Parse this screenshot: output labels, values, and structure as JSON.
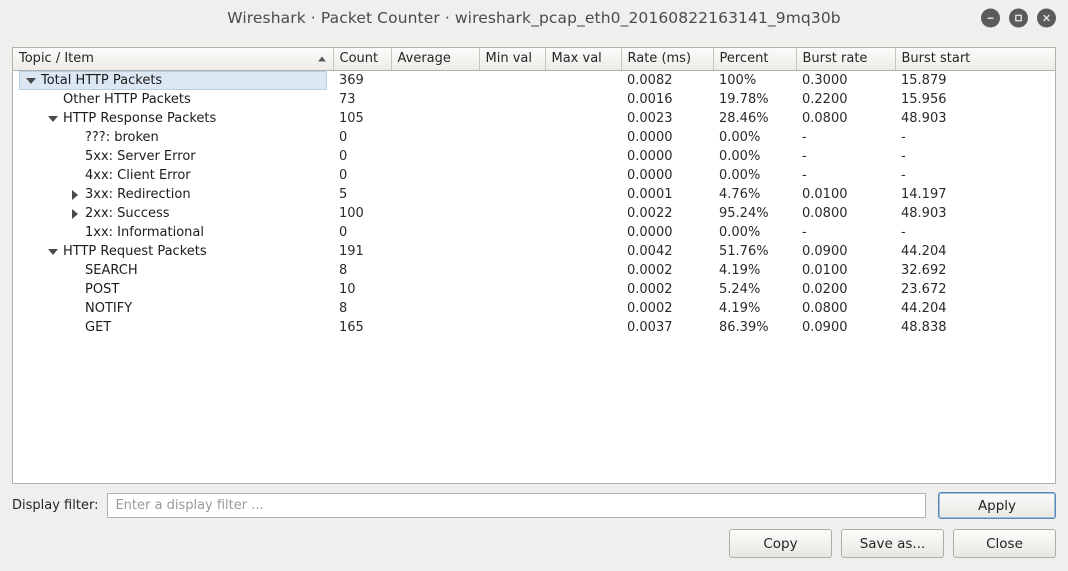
{
  "window": {
    "title": "Wireshark · Packet Counter · wireshark_pcap_eth0_20160822163141_9mq30b",
    "controls": {
      "minimize": "minimize",
      "maximize": "maximize",
      "close": "close"
    }
  },
  "table": {
    "columns": [
      "Topic / Item",
      "Count",
      "Average",
      "Min val",
      "Max val",
      "Rate (ms)",
      "Percent",
      "Burst rate",
      "Burst start"
    ],
    "sort": {
      "column": "Topic / Item",
      "direction": "ascending"
    },
    "rows": [
      {
        "label": "Total HTTP Packets",
        "indent": 0,
        "expander": "expanded",
        "selected": true,
        "count": "369",
        "average": "",
        "min_val": "",
        "max_val": "",
        "rate_ms": "0.0082",
        "percent": "100%",
        "burst_rate": "0.3000",
        "burst_start": "15.879"
      },
      {
        "label": "Other HTTP Packets",
        "indent": 1,
        "expander": "none",
        "selected": false,
        "count": "73",
        "average": "",
        "min_val": "",
        "max_val": "",
        "rate_ms": "0.0016",
        "percent": "19.78%",
        "burst_rate": "0.2200",
        "burst_start": "15.956"
      },
      {
        "label": "HTTP Response Packets",
        "indent": 1,
        "expander": "expanded",
        "selected": false,
        "count": "105",
        "average": "",
        "min_val": "",
        "max_val": "",
        "rate_ms": "0.0023",
        "percent": "28.46%",
        "burst_rate": "0.0800",
        "burst_start": "48.903"
      },
      {
        "label": "???: broken",
        "indent": 2,
        "expander": "none",
        "selected": false,
        "count": "0",
        "average": "",
        "min_val": "",
        "max_val": "",
        "rate_ms": "0.0000",
        "percent": "0.00%",
        "burst_rate": "-",
        "burst_start": "-"
      },
      {
        "label": "5xx: Server Error",
        "indent": 2,
        "expander": "none",
        "selected": false,
        "count": "0",
        "average": "",
        "min_val": "",
        "max_val": "",
        "rate_ms": "0.0000",
        "percent": "0.00%",
        "burst_rate": "-",
        "burst_start": "-"
      },
      {
        "label": "4xx: Client Error",
        "indent": 2,
        "expander": "none",
        "selected": false,
        "count": "0",
        "average": "",
        "min_val": "",
        "max_val": "",
        "rate_ms": "0.0000",
        "percent": "0.00%",
        "burst_rate": "-",
        "burst_start": "-"
      },
      {
        "label": "3xx: Redirection",
        "indent": 2,
        "expander": "collapsed",
        "selected": false,
        "count": "5",
        "average": "",
        "min_val": "",
        "max_val": "",
        "rate_ms": "0.0001",
        "percent": "4.76%",
        "burst_rate": "0.0100",
        "burst_start": "14.197"
      },
      {
        "label": "2xx: Success",
        "indent": 2,
        "expander": "collapsed",
        "selected": false,
        "count": "100",
        "average": "",
        "min_val": "",
        "max_val": "",
        "rate_ms": "0.0022",
        "percent": "95.24%",
        "burst_rate": "0.0800",
        "burst_start": "48.903"
      },
      {
        "label": "1xx: Informational",
        "indent": 2,
        "expander": "none",
        "selected": false,
        "count": "0",
        "average": "",
        "min_val": "",
        "max_val": "",
        "rate_ms": "0.0000",
        "percent": "0.00%",
        "burst_rate": "-",
        "burst_start": "-"
      },
      {
        "label": "HTTP Request Packets",
        "indent": 1,
        "expander": "expanded",
        "selected": false,
        "count": "191",
        "average": "",
        "min_val": "",
        "max_val": "",
        "rate_ms": "0.0042",
        "percent": "51.76%",
        "burst_rate": "0.0900",
        "burst_start": "44.204"
      },
      {
        "label": "SEARCH",
        "indent": 2,
        "expander": "none",
        "selected": false,
        "count": "8",
        "average": "",
        "min_val": "",
        "max_val": "",
        "rate_ms": "0.0002",
        "percent": "4.19%",
        "burst_rate": "0.0100",
        "burst_start": "32.692"
      },
      {
        "label": "POST",
        "indent": 2,
        "expander": "none",
        "selected": false,
        "count": "10",
        "average": "",
        "min_val": "",
        "max_val": "",
        "rate_ms": "0.0002",
        "percent": "5.24%",
        "burst_rate": "0.0200",
        "burst_start": "23.672"
      },
      {
        "label": "NOTIFY",
        "indent": 2,
        "expander": "none",
        "selected": false,
        "count": "8",
        "average": "",
        "min_val": "",
        "max_val": "",
        "rate_ms": "0.0002",
        "percent": "4.19%",
        "burst_rate": "0.0800",
        "burst_start": "44.204"
      },
      {
        "label": "GET",
        "indent": 2,
        "expander": "none",
        "selected": false,
        "count": "165",
        "average": "",
        "min_val": "",
        "max_val": "",
        "rate_ms": "0.0037",
        "percent": "86.39%",
        "burst_rate": "0.0900",
        "burst_start": "48.838"
      }
    ]
  },
  "filter": {
    "label": "Display filter:",
    "value": "",
    "placeholder": "Enter a display filter ...",
    "apply_label": "Apply"
  },
  "buttons": {
    "copy": "Copy",
    "save_as": "Save as...",
    "close": "Close"
  },
  "colors": {
    "window_bg": "#f0efed",
    "table_bg": "#ffffff",
    "selection": "#dbe7f2",
    "focus_border": "#5b87b5"
  }
}
